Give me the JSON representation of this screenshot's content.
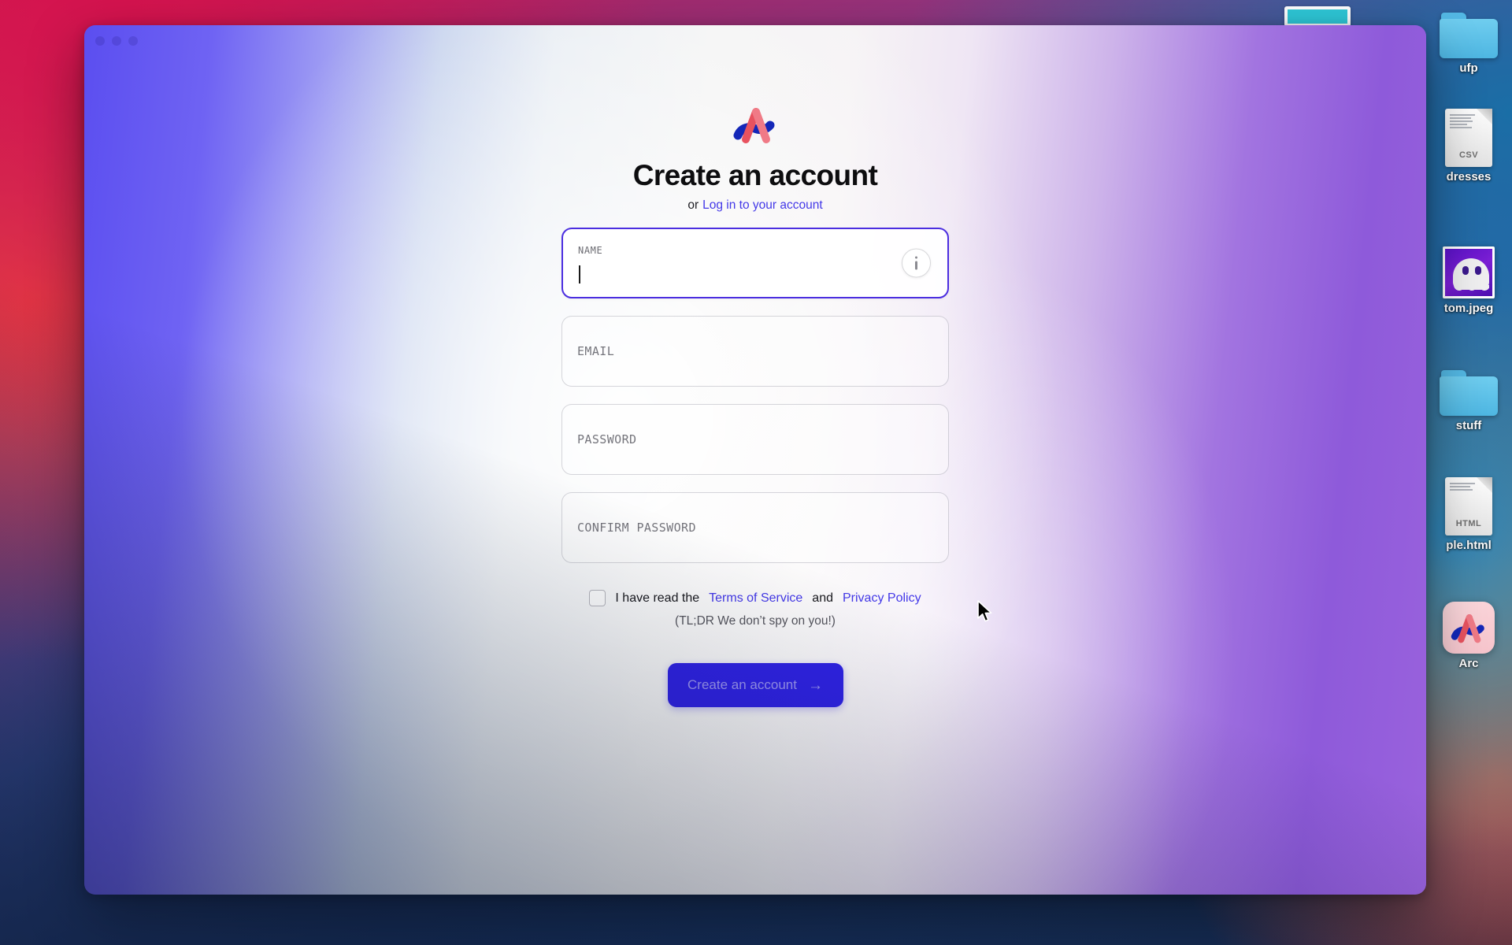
{
  "window": {
    "traffic_lights": [
      "close",
      "minimize",
      "zoom"
    ],
    "accent_color": "#4338e8",
    "button_color": "#2f22e6",
    "focus_border_color": "#4b2ee0"
  },
  "auth": {
    "logo_name": "arc-logo",
    "title": "Create an account",
    "subtitle_prefix": "or",
    "subtitle_link": "Log in to your account",
    "fields": [
      {
        "key": "name",
        "label": "NAME",
        "placeholder": "NAME",
        "value": "",
        "focused": true,
        "has_info": true
      },
      {
        "key": "email",
        "label": "EMAIL",
        "placeholder": "EMAIL",
        "value": "",
        "focused": false,
        "has_info": false
      },
      {
        "key": "password",
        "label": "PASSWORD",
        "placeholder": "PASSWORD",
        "value": "",
        "focused": false,
        "has_info": false
      },
      {
        "key": "confirm",
        "label": "CONFIRM PASSWORD",
        "placeholder": "CONFIRM PASSWORD",
        "value": "",
        "focused": false,
        "has_info": false
      }
    ],
    "consent": {
      "checked": false,
      "text_before": "I have read the",
      "terms_link": "Terms of Service",
      "text_between": "and",
      "privacy_link": "Privacy Policy",
      "tldr": "(TL;DR We don’t spy on you!)"
    },
    "submit": {
      "label": "Create an account",
      "arrow": "→",
      "enabled": false
    }
  },
  "desktop": {
    "icons": [
      {
        "name": "ufp",
        "type": "folder"
      },
      {
        "name": "dresses",
        "type": "csv",
        "ext": "CSV"
      },
      {
        "name": "tom.jpeg",
        "type": "image"
      },
      {
        "name": "stuff",
        "type": "folder"
      },
      {
        "name": "ple.html",
        "type": "html",
        "ext": "HTML"
      },
      {
        "name": "Arc",
        "type": "app"
      }
    ],
    "teal_widget": "teal-window-strip"
  }
}
